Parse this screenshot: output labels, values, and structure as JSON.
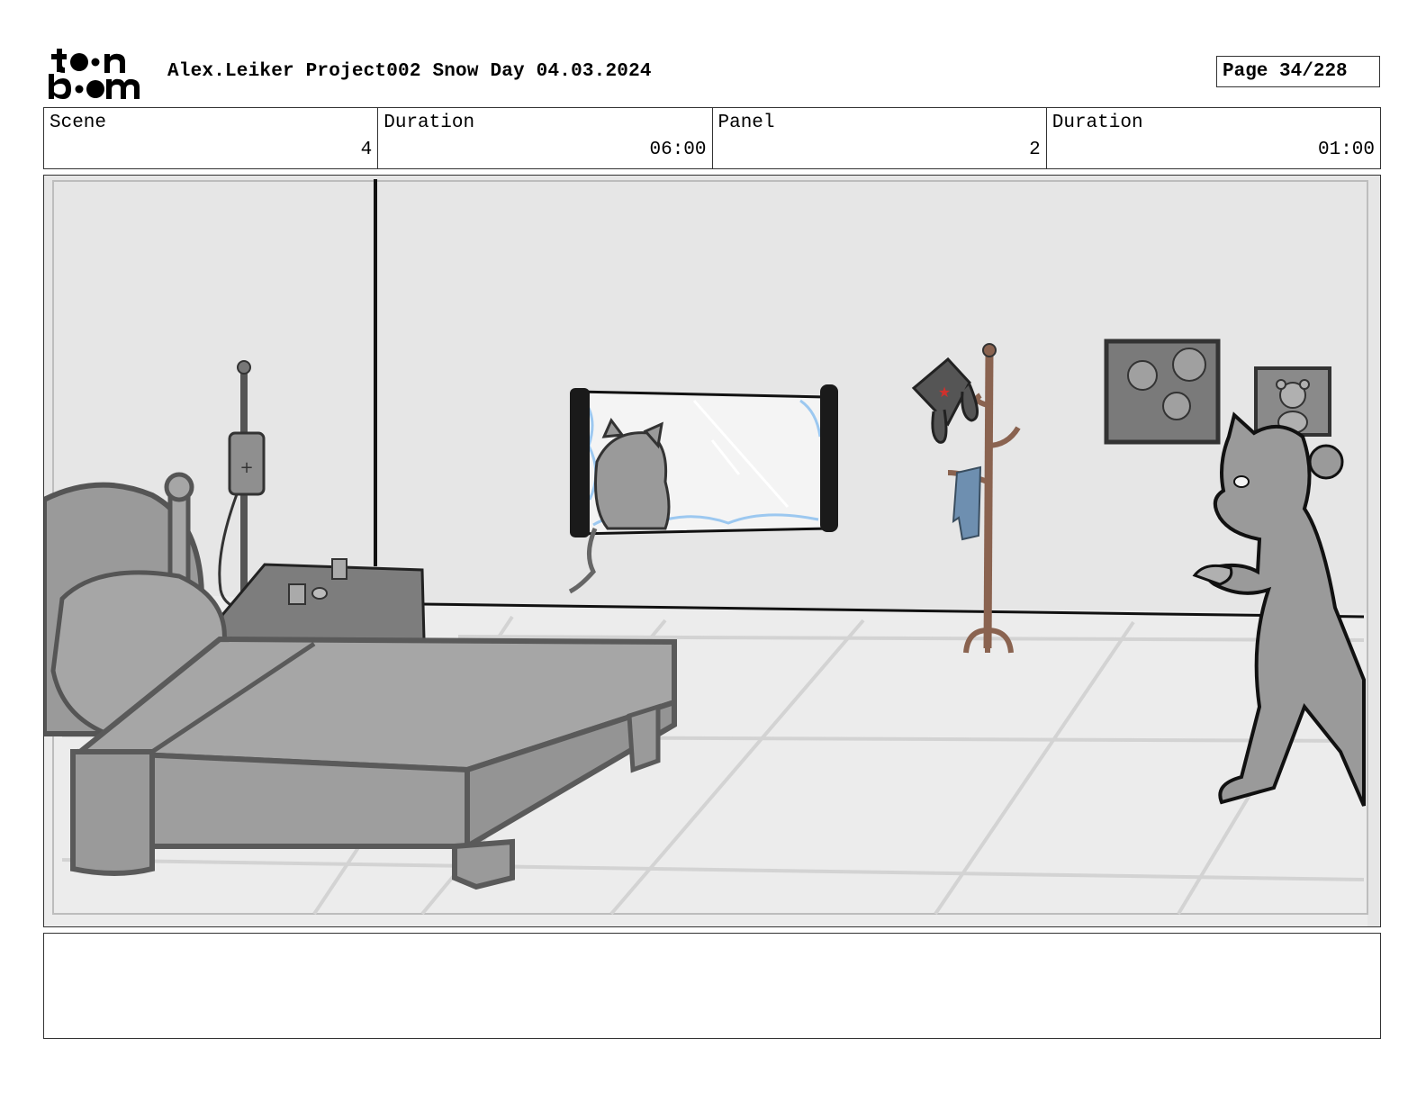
{
  "header": {
    "logo_text": "toon boom",
    "project_title": "Alex.Leiker Project002 Snow Day 04.03.2024",
    "page_label": "Page",
    "page_number": "34/228"
  },
  "info": {
    "scene_label": "Scene",
    "scene_value": "4",
    "scene_duration_label": "Duration",
    "scene_duration_value": "06:00",
    "panel_label": "Panel",
    "panel_value": "2",
    "panel_duration_label": "Duration",
    "panel_duration_value": "01:00"
  },
  "notes": {
    "text": ""
  },
  "colors": {
    "wall": "#e6e6e6",
    "floor": "#ebebeb",
    "furniture": "#a6a6a6",
    "outline": "#111111",
    "coat_rack": "#8a6350",
    "scarf": "#6e8fb0",
    "snow": "#9cc8f0",
    "star": "#d0312d"
  },
  "icons": [
    "toon-boom-logo"
  ]
}
